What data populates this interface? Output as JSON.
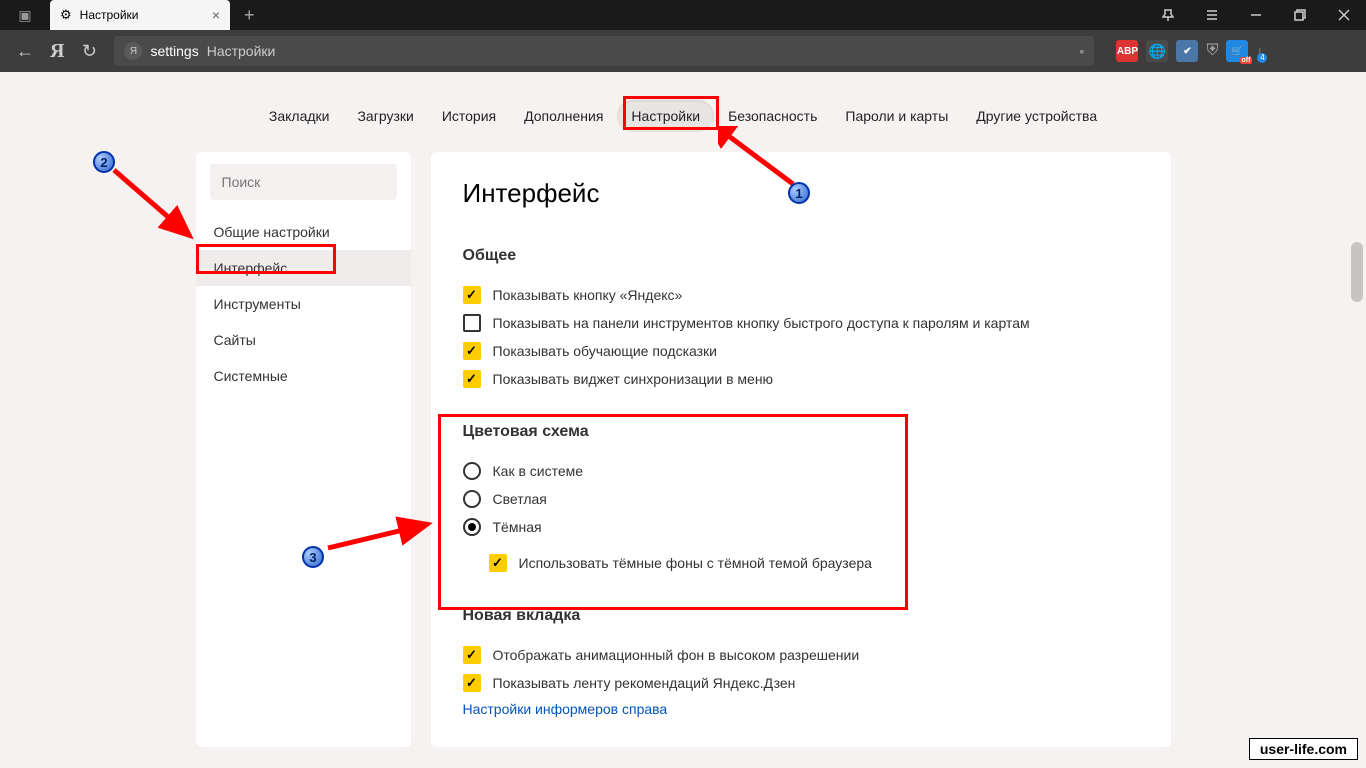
{
  "titlebar": {
    "tab_title": "Настройки"
  },
  "url": {
    "settings": "settings",
    "title": "Настройки"
  },
  "subnav": {
    "items": [
      "Закладки",
      "Загрузки",
      "История",
      "Дополнения",
      "Настройки",
      "Безопасность",
      "Пароли и карты",
      "Другие устройства"
    ]
  },
  "sidebar": {
    "search_placeholder": "Поиск",
    "items": [
      "Общие настройки",
      "Интерфейс",
      "Инструменты",
      "Сайты",
      "Системные"
    ]
  },
  "pane": {
    "title": "Интерфейс",
    "section_general": {
      "title": "Общее",
      "opt1": "Показывать кнопку «Яндекс»",
      "opt2": "Показывать на панели инструментов кнопку быстрого доступа к паролям и картам",
      "opt3": "Показывать обучающие подсказки",
      "opt4": "Показывать виджет синхронизации в меню"
    },
    "section_color": {
      "title": "Цветовая схема",
      "opt1": "Как в системе",
      "opt2": "Светлая",
      "opt3": "Тёмная",
      "opt3_sub": "Использовать тёмные фоны с тёмной темой браузера"
    },
    "section_newtab": {
      "title": "Новая вкладка",
      "opt1": "Отображать анимационный фон в высоком разрешении",
      "opt2": "Показывать ленту рекомендаций Яндекс.Дзен",
      "link": "Настройки информеров справа"
    }
  },
  "watermark": "user-life.com"
}
